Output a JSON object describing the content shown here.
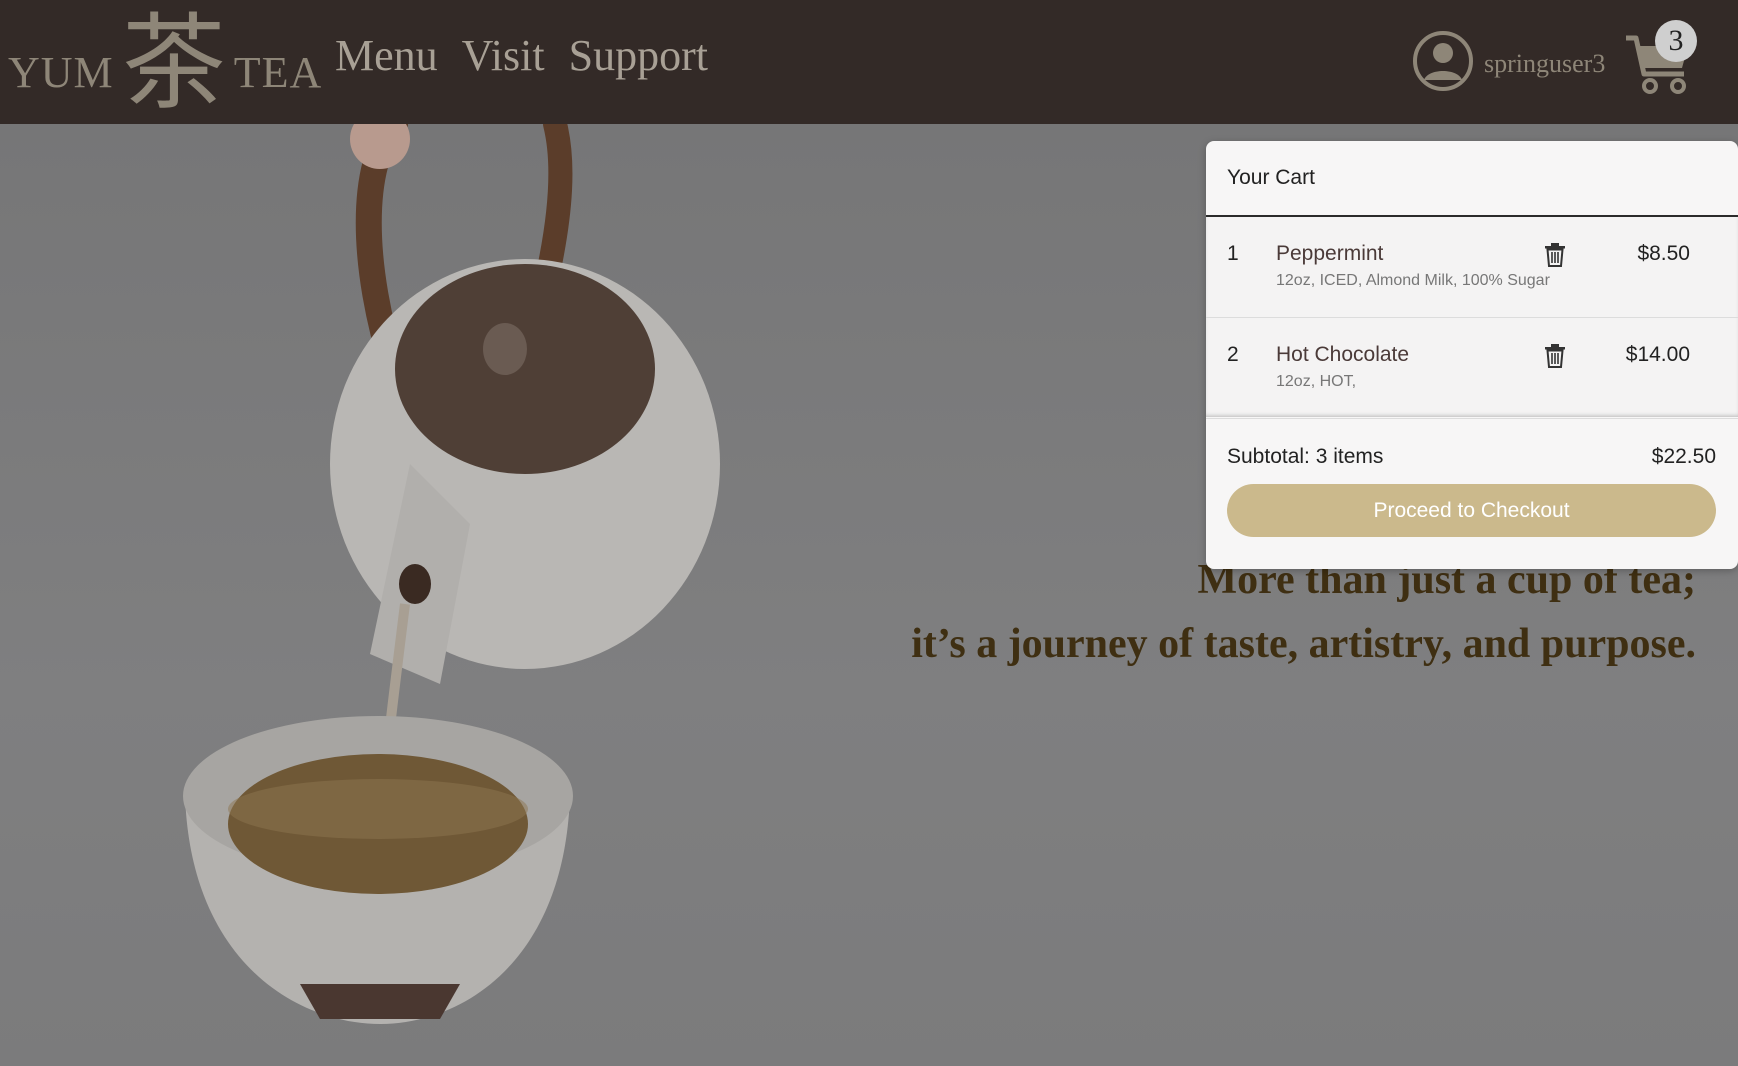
{
  "brand": {
    "left": "YUM",
    "glyph": "茶",
    "right": "TEA"
  },
  "nav": {
    "menu": "Menu",
    "visit": "Visit",
    "support": "Support"
  },
  "user": {
    "name": "springuser3"
  },
  "cart_badge": "3",
  "hero": {
    "line1": "More than just a cup of tea;",
    "line2": "it’s a journey of taste, artistry, and purpose."
  },
  "cart": {
    "title": "Your Cart",
    "items": [
      {
        "num": "1",
        "name": "Peppermint",
        "options": "12oz, ICED, Almond Milk, 100% Sugar",
        "price": "$8.50"
      },
      {
        "num": "2",
        "name": "Hot Chocolate",
        "options": "12oz, HOT,",
        "price": "$14.00"
      }
    ],
    "subtotal_label": "Subtotal: 3 items",
    "subtotal_price": "$22.50",
    "checkout_label": "Proceed to Checkout"
  },
  "colors": {
    "header": "#332a27",
    "accent": "#cbb98c",
    "tagline": "#3f2f12"
  }
}
